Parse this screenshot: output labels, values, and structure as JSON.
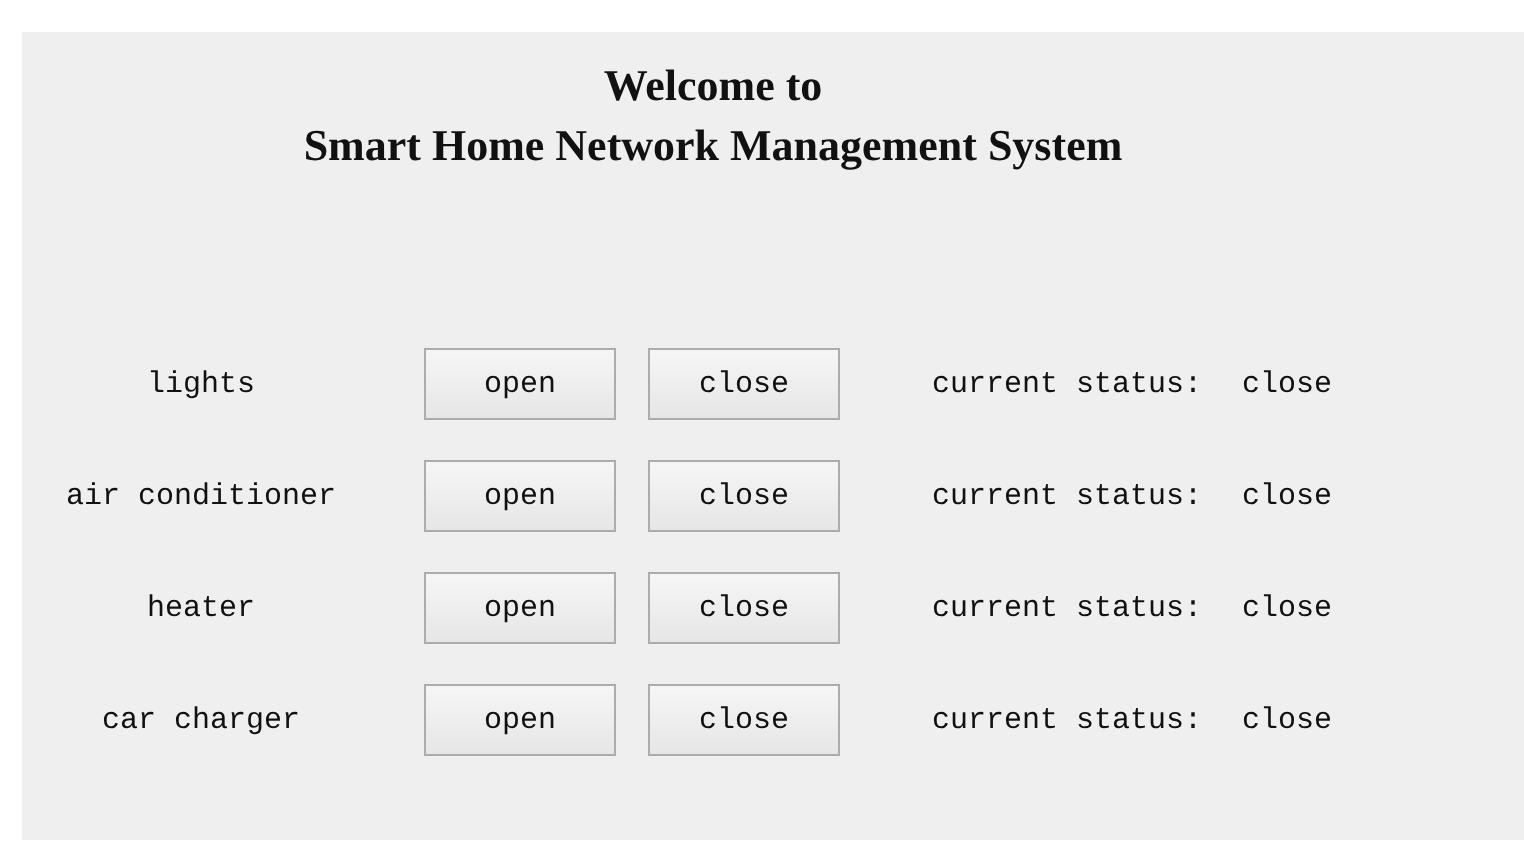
{
  "title_lines": [
    "Welcome to",
    "Smart Home Network Management System"
  ],
  "devices": [
    {
      "name": "lights",
      "buttons": [
        "open",
        "close"
      ],
      "status_label": "current status:",
      "status": "close"
    },
    {
      "name": "air conditioner",
      "buttons": [
        "open",
        "close"
      ],
      "status_label": "current status:",
      "status": "close"
    },
    {
      "name": "heater",
      "buttons": [
        "open",
        "close"
      ],
      "status_label": "current status:",
      "status": "close"
    },
    {
      "name": "car charger",
      "buttons": [
        "open",
        "close"
      ],
      "status_label": "current status:",
      "status": "close"
    }
  ]
}
